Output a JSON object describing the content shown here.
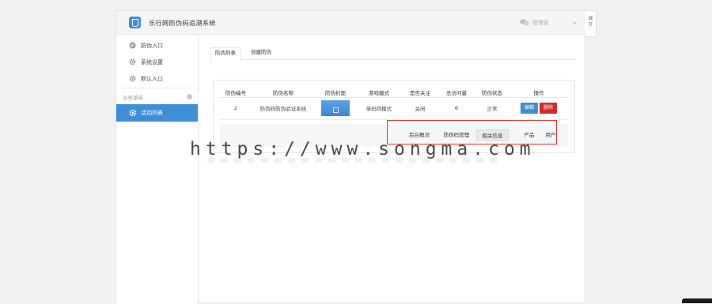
{
  "app": {
    "title": "乐行网防伪码追溯系统",
    "user_label": "管理员",
    "side_tab_label": "展开"
  },
  "sidebar": {
    "items": [
      {
        "label": "防伪入口",
        "icon": "chat-bubble-icon"
      },
      {
        "label": "系统设置",
        "icon": "gear-icon"
      },
      {
        "label": "默认入口",
        "icon": "gear-icon"
      }
    ],
    "section_title": "业务菜单",
    "active_item": {
      "label": "活动列表",
      "icon": "gear-icon"
    }
  },
  "tabs": [
    "防伪列表",
    "创建防伪"
  ],
  "table": {
    "headers": [
      "防伪编号",
      "防伪名称",
      "防伪封面",
      "游戏模式",
      "是否关注",
      "总访问量",
      "防伪状态",
      "操作"
    ],
    "rows": [
      {
        "id": "2",
        "name": "防伪码防伪验证系统",
        "mode": "单码同模式",
        "follow": "关闭",
        "visits": "6",
        "status": "正常",
        "edit_label": "编辑",
        "delete_label": "删除"
      }
    ]
  },
  "footer_tabs": [
    "后台概况",
    "防伪码管理",
    "相关信息",
    "产品",
    "用户"
  ],
  "watermark": "https://www.songma.com",
  "colors": {
    "accent": "#3f8fd8",
    "danger": "#d42a2a",
    "status_ok": "#2da44e",
    "highlight_frame": "#e03a3a"
  }
}
